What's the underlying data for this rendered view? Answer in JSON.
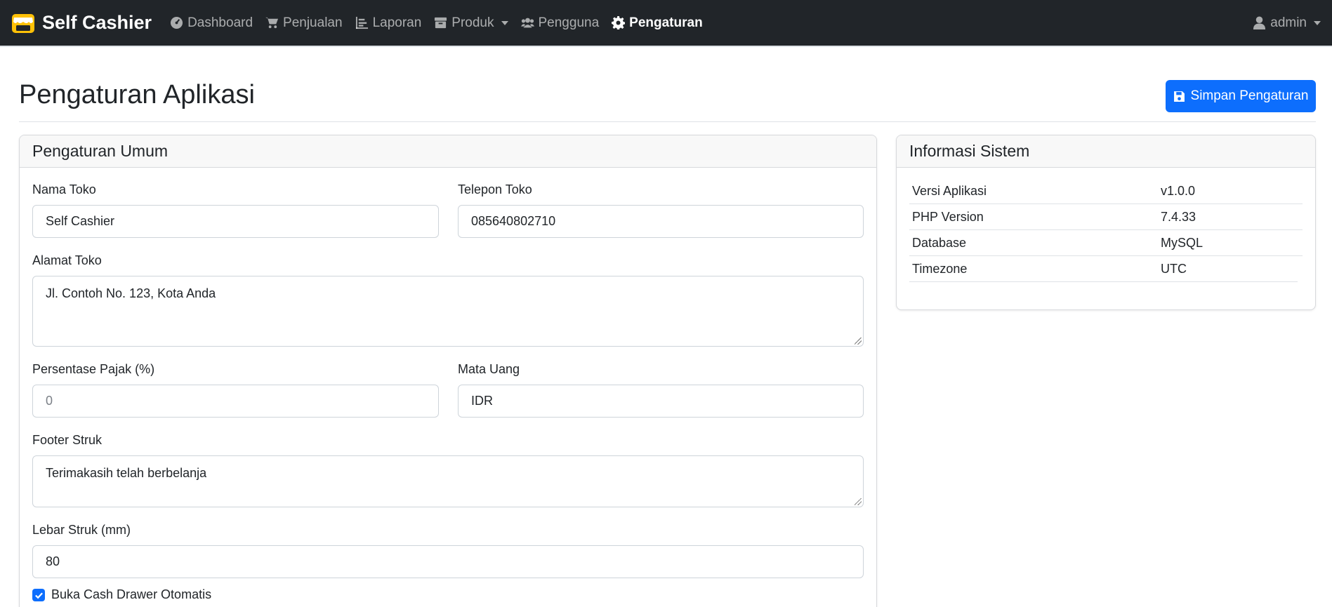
{
  "brand": {
    "name": "Self Cashier",
    "icon": "store-icon",
    "icon_color": "#ffc107"
  },
  "nav": {
    "items": [
      {
        "label": "Dashboard",
        "icon": "gauge-icon",
        "active": false
      },
      {
        "label": "Penjualan",
        "icon": "cart-icon",
        "active": false
      },
      {
        "label": "Laporan",
        "icon": "chart-icon",
        "active": false
      },
      {
        "label": "Produk",
        "icon": "box-icon",
        "active": false,
        "dropdown": true
      },
      {
        "label": "Pengguna",
        "icon": "users-icon",
        "active": false
      },
      {
        "label": "Pengaturan",
        "icon": "gear-icon",
        "active": true
      }
    ],
    "user": "admin"
  },
  "page": {
    "title": "Pengaturan Aplikasi",
    "save_label": "Simpan Pengaturan",
    "accent": "#0d6efd"
  },
  "general": {
    "title": "Pengaturan Umum",
    "store_name_label": "Nama Toko",
    "store_name_value": "Self Cashier",
    "phone_label": "Telepon Toko",
    "phone_value": "085640802710",
    "address_label": "Alamat Toko",
    "address_value": "Jl. Contoh No. 123, Kota Anda",
    "tax_label": "Persentase Pajak (%)",
    "tax_placeholder": "0",
    "currency_label": "Mata Uang",
    "currency_value": "IDR",
    "footer_label": "Footer Struk",
    "footer_value": "Terimakasih telah berbelanja",
    "width_label": "Lebar Struk (mm)",
    "width_value": "80",
    "cash_drawer_label": "Buka Cash Drawer Otomatis",
    "cash_drawer_checked": true
  },
  "system": {
    "title": "Informasi Sistem",
    "rows": [
      {
        "key": "Versi Aplikasi",
        "value": "v1.0.0"
      },
      {
        "key": "PHP Version",
        "value": "7.4.33"
      },
      {
        "key": "Database",
        "value": "MySQL"
      },
      {
        "key": "Timezone",
        "value": "UTC"
      }
    ]
  }
}
